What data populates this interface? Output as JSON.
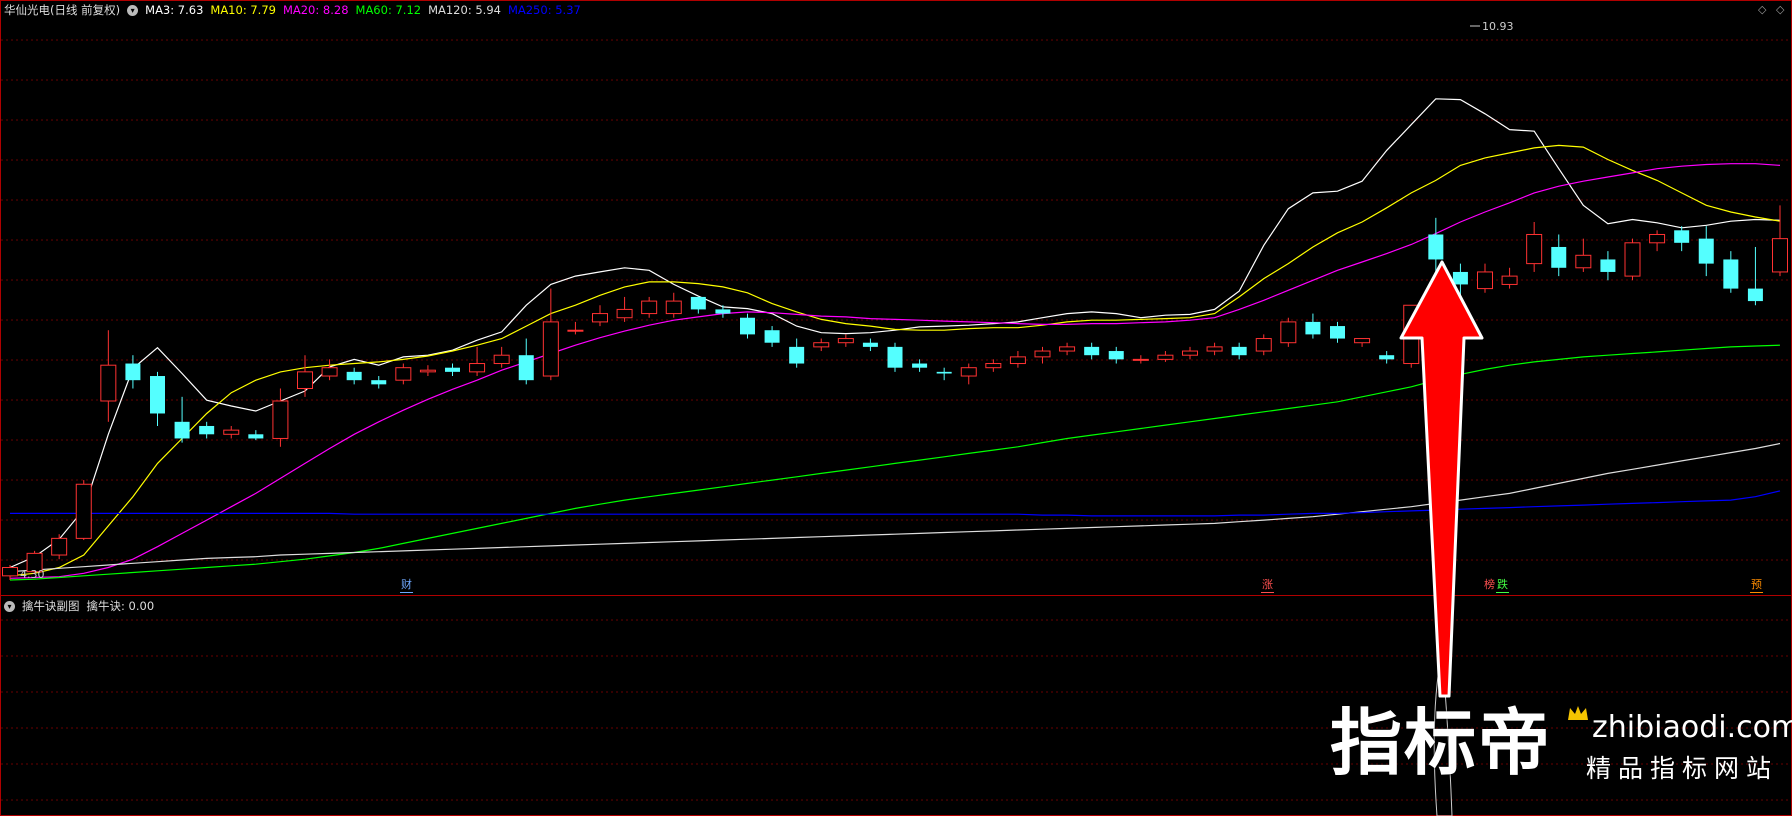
{
  "header": {
    "stock_title": "华仙光电(日线 前复权)",
    "indicators": [
      {
        "label": "MA3: 7.63",
        "color": "#ffffff"
      },
      {
        "label": "MA10: 7.79",
        "color": "#ffff00"
      },
      {
        "label": "MA20: 8.28",
        "color": "#ff00ff"
      },
      {
        "label": "MA60: 7.12",
        "color": "#00ff00"
      },
      {
        "label": "MA120: 5.94",
        "color": "#dddddd"
      },
      {
        "label": "MA250: 5.37",
        "color": "#0000ff"
      }
    ]
  },
  "sub_panel": {
    "title": "擒牛诀副图",
    "value_label": "擒牛诀: 0.00"
  },
  "labels": {
    "high_price": "10.93",
    "low_price": "4.30"
  },
  "markers": [
    {
      "text": "财",
      "color": "#6fa8ff"
    },
    {
      "text": "涨",
      "color": "#ff5050"
    },
    {
      "text": "榜",
      "color": "#ff5050"
    },
    {
      "text": "跌",
      "color": "#44ff44"
    },
    {
      "text": "预",
      "color": "#ff8c00"
    }
  ],
  "watermark": {
    "brand": "指标帝",
    "url": "zhibiaodi.com",
    "slogan": "精品指标网站"
  },
  "colors": {
    "up": "#ff3232",
    "down": "#54ffff",
    "border": "#b00000",
    "grid": "#6a0000",
    "arrow": "#ff0000"
  },
  "chart_data": {
    "type": "candlestick",
    "price_axis": {
      "min": 4.3,
      "max": 10.93
    },
    "series": [
      {
        "name": "MA3",
        "color": "#ffffff",
        "values": [
          4.45,
          4.58,
          4.79,
          5.15,
          6.05,
          6.84,
          7.09,
          6.78,
          6.46,
          6.39,
          6.33,
          6.45,
          6.57,
          6.86,
          6.95,
          6.88,
          6.98,
          7.0,
          7.06,
          7.18,
          7.28,
          7.6,
          7.85,
          7.95,
          8.0,
          8.05,
          8.02,
          7.85,
          7.71,
          7.58,
          7.56,
          7.5,
          7.35,
          7.27,
          7.26,
          7.27,
          7.3,
          7.34,
          7.35,
          7.36,
          7.38,
          7.4,
          7.45,
          7.5,
          7.52,
          7.5,
          7.45,
          7.48,
          7.49,
          7.55,
          7.77,
          8.32,
          8.76,
          8.95,
          8.97,
          9.09,
          9.46,
          9.77,
          10.08,
          10.07,
          9.9,
          9.71,
          9.69,
          9.24,
          8.8,
          8.58,
          8.63,
          8.59,
          8.53,
          8.56,
          8.61,
          8.63,
          8.62
        ]
      },
      {
        "name": "MA10",
        "color": "#ffff00",
        "values": [
          4.35,
          4.38,
          4.45,
          4.6,
          4.95,
          5.3,
          5.7,
          6.0,
          6.3,
          6.55,
          6.7,
          6.8,
          6.85,
          6.88,
          6.9,
          6.92,
          6.95,
          6.99,
          7.05,
          7.12,
          7.2,
          7.35,
          7.5,
          7.6,
          7.72,
          7.82,
          7.88,
          7.88,
          7.86,
          7.82,
          7.75,
          7.62,
          7.52,
          7.43,
          7.38,
          7.35,
          7.31,
          7.3,
          7.3,
          7.32,
          7.33,
          7.33,
          7.36,
          7.4,
          7.42,
          7.42,
          7.43,
          7.44,
          7.45,
          7.5,
          7.7,
          7.92,
          8.1,
          8.3,
          8.47,
          8.6,
          8.77,
          8.95,
          9.1,
          9.28,
          9.37,
          9.43,
          9.49,
          9.52,
          9.5,
          9.35,
          9.22,
          9.1,
          8.95,
          8.8,
          8.72,
          8.66,
          8.61
        ]
      },
      {
        "name": "MA20",
        "color": "#ff00ff",
        "values": [
          4.32,
          4.33,
          4.34,
          4.38,
          4.45,
          4.55,
          4.7,
          4.86,
          5.02,
          5.18,
          5.34,
          5.52,
          5.7,
          5.88,
          6.05,
          6.2,
          6.34,
          6.47,
          6.59,
          6.7,
          6.82,
          6.92,
          7.02,
          7.12,
          7.21,
          7.29,
          7.36,
          7.42,
          7.46,
          7.5,
          7.52,
          7.51,
          7.49,
          7.47,
          7.46,
          7.44,
          7.43,
          7.42,
          7.41,
          7.4,
          7.39,
          7.38,
          7.37,
          7.37,
          7.38,
          7.38,
          7.39,
          7.4,
          7.42,
          7.45,
          7.55,
          7.66,
          7.78,
          7.9,
          8.02,
          8.12,
          8.22,
          8.33,
          8.46,
          8.6,
          8.72,
          8.83,
          8.95,
          9.03,
          9.09,
          9.14,
          9.19,
          9.24,
          9.27,
          9.29,
          9.3,
          9.3,
          9.28
        ]
      },
      {
        "name": "MA60",
        "color": "#00ff00",
        "values": [
          4.3,
          4.31,
          4.33,
          4.35,
          4.37,
          4.39,
          4.41,
          4.43,
          4.45,
          4.47,
          4.49,
          4.52,
          4.55,
          4.59,
          4.63,
          4.68,
          4.74,
          4.8,
          4.86,
          4.92,
          4.98,
          5.04,
          5.1,
          5.16,
          5.21,
          5.26,
          5.3,
          5.34,
          5.38,
          5.42,
          5.46,
          5.5,
          5.54,
          5.58,
          5.62,
          5.66,
          5.7,
          5.74,
          5.78,
          5.82,
          5.86,
          5.9,
          5.95,
          6.0,
          6.04,
          6.08,
          6.12,
          6.16,
          6.2,
          6.24,
          6.28,
          6.32,
          6.36,
          6.4,
          6.44,
          6.5,
          6.56,
          6.62,
          6.7,
          6.77,
          6.83,
          6.88,
          6.92,
          6.95,
          6.98,
          7.0,
          7.02,
          7.04,
          7.06,
          7.08,
          7.1,
          7.11,
          7.12
        ]
      },
      {
        "name": "MA120",
        "color": "#dddddd",
        "values": [
          4.4,
          4.42,
          4.44,
          4.46,
          4.48,
          4.5,
          4.52,
          4.54,
          4.56,
          4.57,
          4.58,
          4.6,
          4.61,
          4.62,
          4.63,
          4.64,
          4.65,
          4.66,
          4.67,
          4.68,
          4.69,
          4.7,
          4.71,
          4.72,
          4.73,
          4.74,
          4.75,
          4.76,
          4.77,
          4.78,
          4.79,
          4.8,
          4.81,
          4.82,
          4.83,
          4.84,
          4.85,
          4.86,
          4.87,
          4.88,
          4.89,
          4.9,
          4.91,
          4.92,
          4.93,
          4.94,
          4.95,
          4.96,
          4.97,
          4.98,
          5.0,
          5.02,
          5.04,
          5.06,
          5.09,
          5.12,
          5.15,
          5.18,
          5.22,
          5.26,
          5.3,
          5.34,
          5.4,
          5.46,
          5.52,
          5.58,
          5.63,
          5.68,
          5.73,
          5.78,
          5.83,
          5.88,
          5.94
        ]
      },
      {
        "name": "MA250",
        "color": "#0000ff",
        "values": [
          5.1,
          5.1,
          5.1,
          5.1,
          5.1,
          5.1,
          5.1,
          5.1,
          5.1,
          5.1,
          5.1,
          5.1,
          5.1,
          5.1,
          5.09,
          5.09,
          5.09,
          5.09,
          5.09,
          5.09,
          5.09,
          5.09,
          5.09,
          5.09,
          5.09,
          5.09,
          5.09,
          5.09,
          5.09,
          5.09,
          5.09,
          5.09,
          5.09,
          5.09,
          5.09,
          5.09,
          5.09,
          5.09,
          5.09,
          5.09,
          5.09,
          5.09,
          5.08,
          5.08,
          5.07,
          5.07,
          5.07,
          5.07,
          5.07,
          5.07,
          5.08,
          5.08,
          5.09,
          5.1,
          5.1,
          5.11,
          5.12,
          5.13,
          5.14,
          5.15,
          5.16,
          5.17,
          5.18,
          5.19,
          5.2,
          5.21,
          5.22,
          5.23,
          5.24,
          5.25,
          5.26,
          5.3,
          5.37
        ]
      }
    ],
    "candles": [
      [
        4.35,
        4.45,
        4.3,
        4.48
      ],
      [
        4.4,
        4.62,
        4.38,
        4.65
      ],
      [
        4.6,
        4.8,
        4.55,
        4.85
      ],
      [
        4.8,
        5.45,
        4.78,
        5.5
      ],
      [
        6.45,
        6.88,
        6.2,
        7.3
      ],
      [
        6.9,
        6.7,
        6.6,
        7.0
      ],
      [
        6.75,
        6.3,
        6.15,
        6.8
      ],
      [
        6.2,
        6.0,
        5.95,
        6.5
      ],
      [
        6.15,
        6.05,
        6.0,
        6.2
      ],
      [
        6.05,
        6.1,
        6.0,
        6.15
      ],
      [
        6.05,
        6.0,
        5.98,
        6.1
      ],
      [
        6.0,
        6.45,
        5.9,
        6.6
      ],
      [
        6.6,
        6.8,
        6.5,
        7.0
      ],
      [
        6.75,
        6.85,
        6.7,
        6.95
      ],
      [
        6.8,
        6.7,
        6.65,
        6.85
      ],
      [
        6.7,
        6.65,
        6.6,
        6.75
      ],
      [
        6.7,
        6.85,
        6.65,
        6.9
      ],
      [
        6.8,
        6.82,
        6.75,
        6.88
      ],
      [
        6.85,
        6.8,
        6.75,
        6.9
      ],
      [
        6.8,
        6.9,
        6.75,
        7.1
      ],
      [
        6.9,
        7.0,
        6.85,
        7.1
      ],
      [
        7.0,
        6.7,
        6.65,
        7.2
      ],
      [
        6.75,
        7.4,
        6.7,
        7.8
      ],
      [
        7.3,
        7.3,
        7.25,
        7.4
      ],
      [
        7.4,
        7.5,
        7.35,
        7.6
      ],
      [
        7.45,
        7.55,
        7.4,
        7.7
      ],
      [
        7.5,
        7.65,
        7.45,
        7.7
      ],
      [
        7.5,
        7.65,
        7.45,
        7.75
      ],
      [
        7.7,
        7.55,
        7.5,
        7.7
      ],
      [
        7.55,
        7.5,
        7.45,
        7.6
      ],
      [
        7.45,
        7.25,
        7.2,
        7.5
      ],
      [
        7.3,
        7.15,
        7.1,
        7.35
      ],
      [
        7.1,
        6.9,
        6.85,
        7.2
      ],
      [
        7.1,
        7.15,
        7.05,
        7.2
      ],
      [
        7.15,
        7.2,
        7.1,
        7.25
      ],
      [
        7.15,
        7.1,
        7.05,
        7.2
      ],
      [
        7.1,
        6.85,
        6.8,
        7.15
      ],
      [
        6.9,
        6.85,
        6.8,
        6.95
      ],
      [
        6.8,
        6.78,
        6.7,
        6.85
      ],
      [
        6.75,
        6.85,
        6.65,
        6.9
      ],
      [
        6.85,
        6.9,
        6.8,
        6.95
      ],
      [
        6.9,
        6.98,
        6.85,
        7.05
      ],
      [
        6.98,
        7.05,
        6.9,
        7.1
      ],
      [
        7.05,
        7.1,
        7.0,
        7.15
      ],
      [
        7.1,
        7.0,
        6.95,
        7.15
      ],
      [
        7.05,
        6.95,
        6.9,
        7.1
      ],
      [
        6.95,
        6.95,
        6.9,
        7.0
      ],
      [
        6.95,
        7.0,
        6.92,
        7.05
      ],
      [
        7.0,
        7.05,
        6.95,
        7.1
      ],
      [
        7.05,
        7.1,
        7.0,
        7.15
      ],
      [
        7.1,
        7.0,
        6.95,
        7.15
      ],
      [
        7.05,
        7.2,
        7.0,
        7.25
      ],
      [
        7.15,
        7.4,
        7.1,
        7.45
      ],
      [
        7.4,
        7.25,
        7.2,
        7.5
      ],
      [
        7.35,
        7.2,
        7.15,
        7.4
      ],
      [
        7.15,
        7.2,
        7.1,
        7.2
      ],
      [
        7.0,
        6.95,
        6.9,
        7.05
      ],
      [
        6.9,
        7.6,
        6.85,
        7.6
      ],
      [
        8.45,
        8.15,
        8.0,
        8.65
      ],
      [
        8.0,
        7.85,
        7.7,
        8.1
      ],
      [
        7.8,
        8.0,
        7.75,
        8.1
      ],
      [
        7.85,
        7.95,
        7.8,
        8.05
      ],
      [
        8.1,
        8.45,
        8.0,
        8.6
      ],
      [
        8.3,
        8.05,
        7.95,
        8.45
      ],
      [
        8.05,
        8.2,
        8.0,
        8.4
      ],
      [
        8.15,
        8.0,
        7.9,
        8.25
      ],
      [
        7.95,
        8.35,
        7.9,
        8.4
      ],
      [
        8.35,
        8.45,
        8.25,
        8.5
      ],
      [
        8.5,
        8.35,
        8.25,
        8.55
      ],
      [
        8.4,
        8.1,
        7.95,
        8.55
      ],
      [
        8.15,
        7.8,
        7.75,
        8.25
      ],
      [
        7.8,
        7.65,
        7.6,
        8.3
      ],
      [
        8.0,
        8.4,
        7.95,
        8.8
      ]
    ]
  }
}
